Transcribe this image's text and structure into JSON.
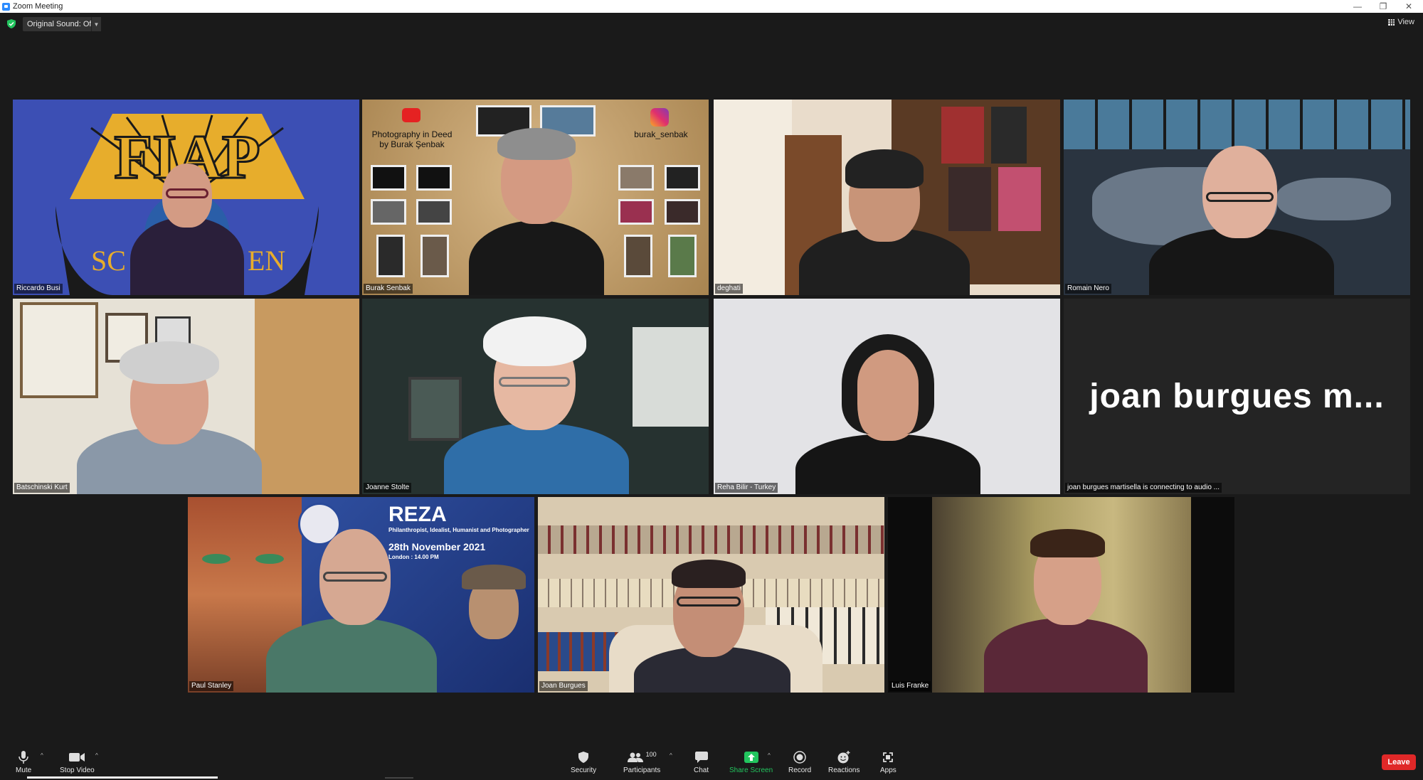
{
  "window": {
    "title": "Zoom Meeting"
  },
  "topbar": {
    "original_sound": "Original Sound: Off",
    "view_label": "View"
  },
  "tiles": [
    {
      "name": "Riccardo Busi"
    },
    {
      "name": "Burak Senbak",
      "background": {
        "title_line1": "Photography in Deed",
        "title_line2": "by Burak Şenbak",
        "handle": "burak_senbak"
      }
    },
    {
      "name": "deghati"
    },
    {
      "name": "Romain Nero"
    },
    {
      "name": "Batschinski Kurt"
    },
    {
      "name": "Joanne Stolte"
    },
    {
      "name": "Reha Bilir - Turkey"
    },
    {
      "name": "joan burgues martisella is connecting to audio ...",
      "display": "joan burgues m..."
    },
    {
      "name": "Paul Stanley",
      "background": {
        "headline": "REZA",
        "subtitle": "Philanthropist, Idealist, Humanist and Photographer",
        "date": "28th November 2021",
        "time": "London : 14.00 PM"
      }
    },
    {
      "name": "Joan Burgues"
    },
    {
      "name": "Luis Franke"
    }
  ],
  "toolbar": {
    "mute": "Mute",
    "stop_video": "Stop Video",
    "security": "Security",
    "participants": "Participants",
    "participants_count": "100",
    "chat": "Chat",
    "share_screen": "Share Screen",
    "record": "Record",
    "reactions": "Reactions",
    "apps": "Apps",
    "leave": "Leave"
  },
  "colors": {
    "accent_green": "#22c55e",
    "leave_red": "#e02828",
    "active_speaker": "#e6e45c",
    "background": "#1a1a1a"
  }
}
